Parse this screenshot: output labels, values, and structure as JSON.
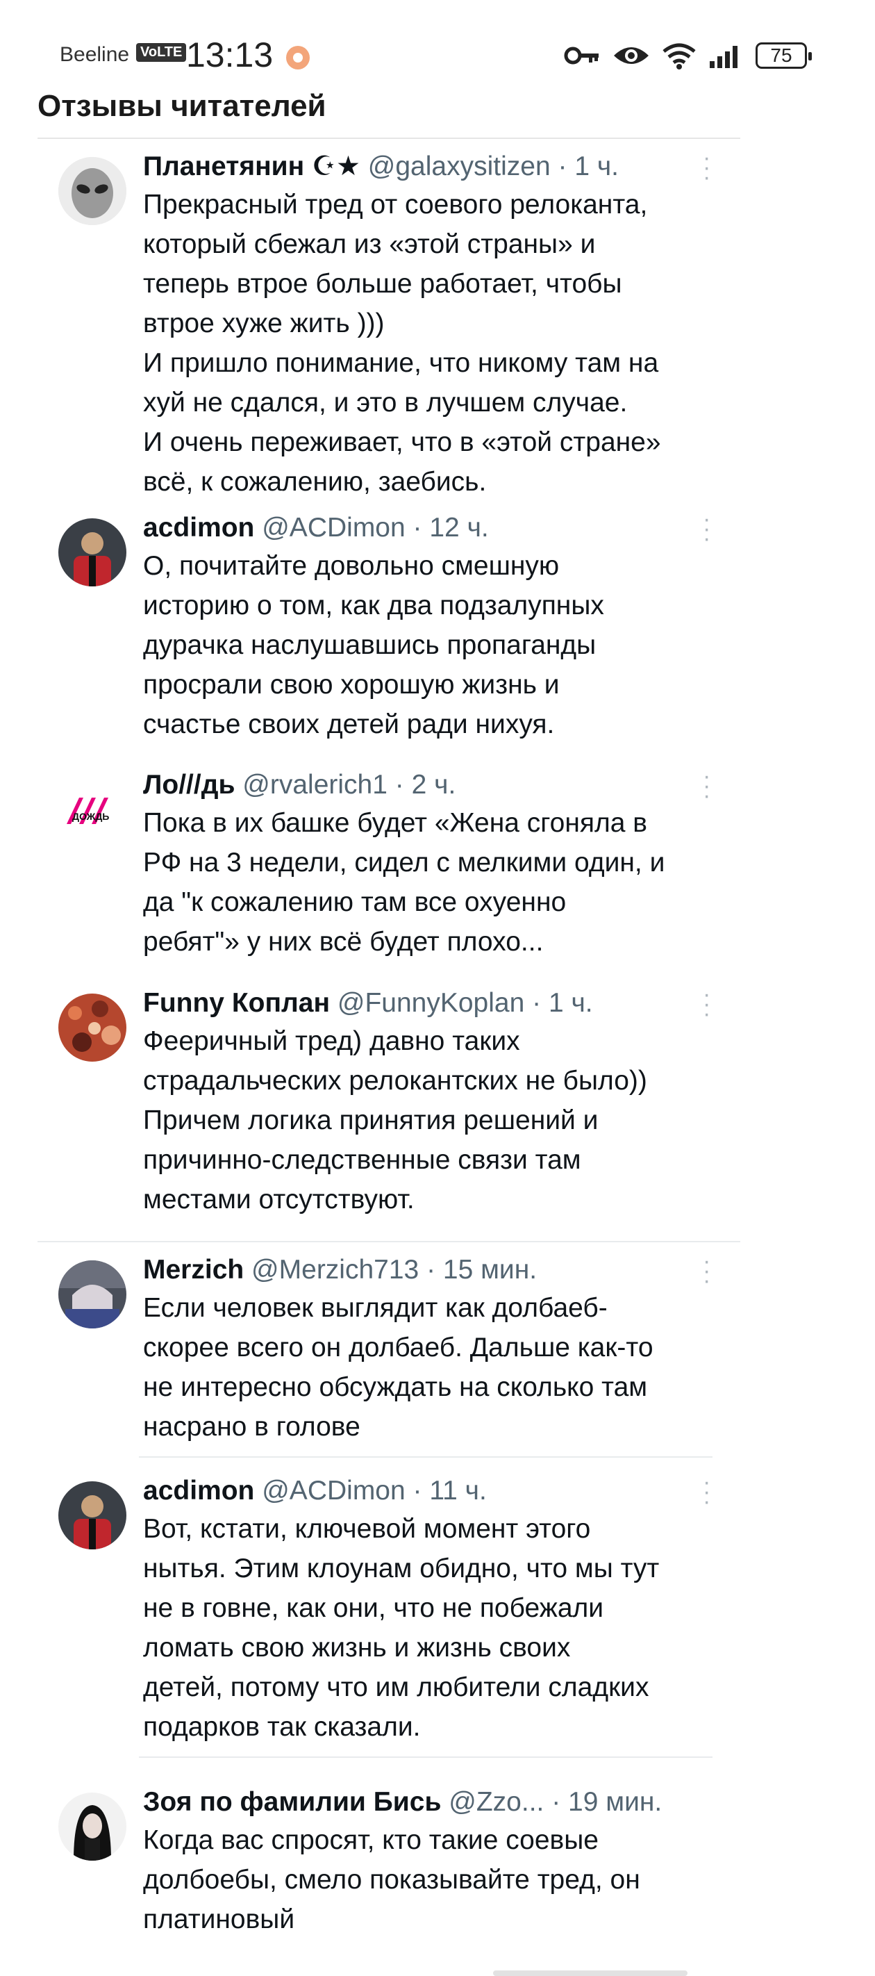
{
  "status_bar": {
    "carrier": "Beeline",
    "volte": "VoLTE",
    "time": "13:13",
    "battery": "75",
    "icons": [
      "key-icon",
      "eye-icon",
      "wifi-icon",
      "signal-icon",
      "battery-icon"
    ]
  },
  "section_title": "Отзывы читателей",
  "comments": [
    {
      "name": "Планетянин ☪★",
      "handle": "@galaxysitizen",
      "time": "· 1 ч.",
      "text": "Прекрасный тред от соевого релоканта,\nкоторый сбежал из «этой страны» и\nтеперь втрое больше работает, чтобы\nвтрое хуже жить )))\nИ пришло понимание, что никому там на\nхуй не сдался, и это в лучшем случае.\nИ очень переживает, что в «этой стране»\nвсё, к сожалению, заебись."
    },
    {
      "name": "acdimon",
      "handle": "@ACDimon",
      "time": "· 12 ч.",
      "text": "О, почитайте довольно смешную\nисторию о том, как два  подзалупных\nдурачка наслушавшись пропаганды\nпросрали свою хорошую жизнь и\nсчастье своих детей ради нихуя."
    },
    {
      "name": "Ло///дь",
      "handle": "@rvalerich1",
      "time": "· 2 ч.",
      "avatar_text": "ДОЖДЬ",
      "text": "Пока в их башке будет «Жена сгоняла в\nРФ на 3 недели, сидел с мелкими один, и\nда \"к сожалению там все охуенно\nребят\"» у них всё будет плохо..."
    },
    {
      "name": "Funny Коплан",
      "handle": "@FunnyKoplan",
      "time": "· 1 ч.",
      "text": "Фееричный тред) давно таких\nстрадальческих релокантских не было))\nПричем логика принятия решений и\nпричинно-следственные связи там\nместами отсутствуют."
    },
    {
      "name": "Merzich",
      "handle": "@Merzich713",
      "time": "· 15 мин.",
      "text": "Если человек выглядит как долбаеб-\nскорее всего он долбаеб. Дальше как-то\nне интересно обсуждать на сколько там\nнасрано в голове"
    },
    {
      "name": "acdimon",
      "handle": "@ACDimon",
      "time": "· 11 ч.",
      "text": "Вот, кстати, ключевой момент этого\nнытья. Этим клоунам обидно, что мы тут\nне в говне, как они, что не побежали\nломать свою жизнь и жизнь своих\nдетей, потому что им любители сладких\nподарков так сказали."
    },
    {
      "name": "Зоя по фамилии Бись",
      "handle": "@Zzo...",
      "time": "· 19 мин.",
      "text": "Когда вас спросят, кто такие соевые\nдолбоебы, смело показывайте тред, он\nплатиновый"
    }
  ]
}
